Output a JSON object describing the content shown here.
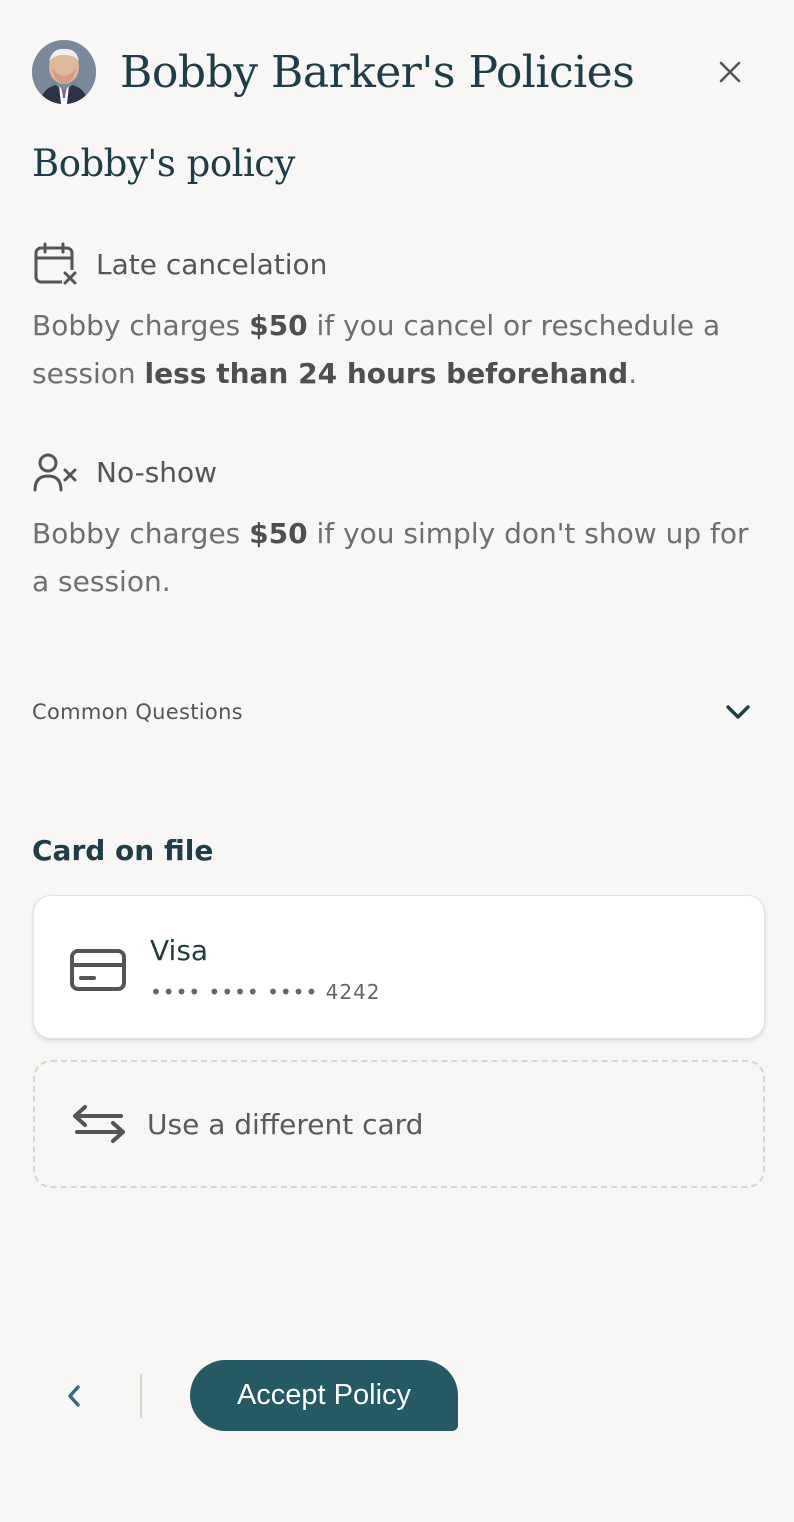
{
  "header": {
    "title": "Bobby Barker's Policies",
    "avatar_alt": "Bobby Barker",
    "close_icon": "close-icon"
  },
  "section_title": "Bobby's policy",
  "policies": {
    "late": {
      "icon": "calendar-x-icon",
      "title": "Late cancelation",
      "text_pre": "Bobby charges ",
      "amount": "$50",
      "text_mid": " if you cancel or reschedule a session ",
      "window": "less than 24 hours beforehand",
      "text_post": "."
    },
    "noshow": {
      "icon": "user-x-icon",
      "title": "No-show",
      "text_pre": "Bobby charges ",
      "amount": "$50",
      "text_post": " if you simply don't show up for a session."
    }
  },
  "faq": {
    "label": "Common Questions",
    "icon": "chevron-down-icon"
  },
  "card_on_file": {
    "heading": "Card on file",
    "brand": "Visa",
    "number": "•••• •••• •••• 4242",
    "icon": "credit-card-icon"
  },
  "alternate_card": {
    "label": "Use a different card",
    "icon": "swap-arrows-icon"
  },
  "footer": {
    "back_icon": "chevron-left-icon",
    "accept_label": "Accept Policy"
  },
  "colors": {
    "background": "#f8f7f5",
    "heading": "#1d3e48",
    "primary_button": "#255a64",
    "accent_icon": "#2f6f7c"
  }
}
